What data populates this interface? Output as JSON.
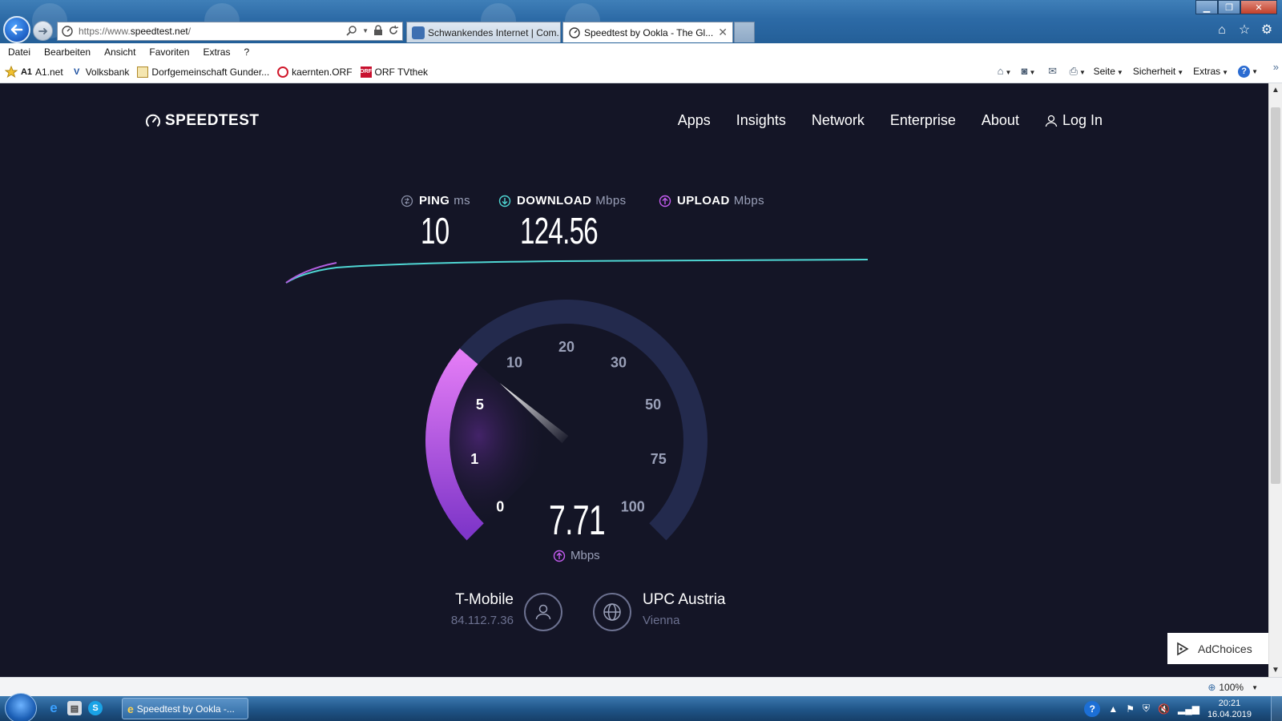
{
  "browser": {
    "address_url_prefix": "https://www.",
    "address_url_domain": "speedtest.net",
    "address_url_suffix": "/",
    "tabs": [
      {
        "label": "Schwankendes Internet | Com..."
      },
      {
        "label": "Speedtest by Ookla - The Gl..."
      }
    ],
    "menu": [
      "Datei",
      "Bearbeiten",
      "Ansicht",
      "Favoriten",
      "Extras",
      "?"
    ],
    "favorites": [
      "A1.net",
      "Volksbank",
      "Dorfgemeinschaft Gunder...",
      "kaernten.ORF",
      "ORF TVthek"
    ],
    "commands": {
      "page": "Seite",
      "safety": "Sicherheit",
      "tools": "Extras"
    },
    "zoom": "100%"
  },
  "site": {
    "logo": "SPEEDTEST",
    "nav": [
      "Apps",
      "Insights",
      "Network",
      "Enterprise",
      "About"
    ],
    "login": "Log In"
  },
  "metrics": {
    "ping": {
      "label": "PING",
      "unit": "ms",
      "value": "10"
    },
    "download": {
      "label": "DOWNLOAD",
      "unit": "Mbps",
      "value": "124.56"
    },
    "upload": {
      "label": "UPLOAD",
      "unit": "Mbps",
      "value": ""
    }
  },
  "gauge": {
    "tick_labels": [
      "0",
      "1",
      "5",
      "10",
      "20",
      "30",
      "50",
      "75",
      "100"
    ],
    "current_value": "7.71",
    "unit": "Mbps",
    "accent_color": "#c45cf0",
    "track_color": "#232a4d"
  },
  "connection": {
    "isp_name": "T-Mobile",
    "isp_ip": "84.112.7.36",
    "server_name": "UPC Austria",
    "server_location": "Vienna"
  },
  "ad": {
    "label": "AdChoices"
  },
  "taskbar": {
    "task_label": "Speedtest by Ookla -...",
    "time": "20:21",
    "date": "16.04.2019"
  }
}
